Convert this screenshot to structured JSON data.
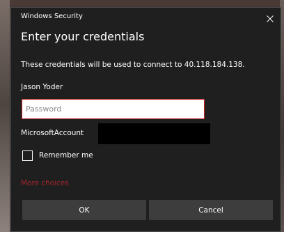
{
  "window": {
    "title": "Windows Security",
    "close_icon": "close-icon"
  },
  "dialog": {
    "heading": "Enter your credentials",
    "info": "These credentials will be used to connect to 40.118.184.138.",
    "username": "Jason Yoder",
    "password": {
      "value": "",
      "placeholder": "Password"
    },
    "account_label": "MicrosoftAccount",
    "remember": {
      "label": "Remember me",
      "checked": false
    },
    "more_choices": "More choices",
    "buttons": {
      "ok": "OK",
      "cancel": "Cancel"
    }
  },
  "colors": {
    "dialog_bg": "#1f1f1f",
    "button_bg": "#3d3d3d",
    "input_focus_border": "#cc1f1f",
    "link": "#a4262c",
    "text": "#ffffff"
  }
}
